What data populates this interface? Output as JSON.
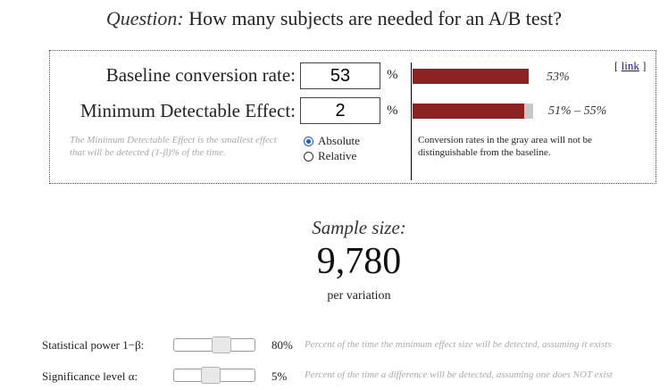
{
  "question": {
    "label": "Question:",
    "text": "How many subjects are needed for an A/B test?"
  },
  "link": {
    "open": "[",
    "text": "link",
    "close": "]"
  },
  "baseline": {
    "label": "Baseline conversion rate:",
    "value": "53",
    "unit": "%",
    "bar_text": "53%",
    "bar_fraction": 0.53
  },
  "mde": {
    "label": "Minimum Detectable Effect:",
    "value": "2",
    "unit": "%",
    "bar_text": "51% – 55%",
    "bar_red_fraction": 0.51,
    "bar_gray_to_fraction": 0.55
  },
  "mde_help": "The Minimum Detectable Effect is the smallest effect that will be detected (1-β)% of the time.",
  "mode": {
    "absolute": "Absolute",
    "relative": "Relative",
    "selected": "Absolute"
  },
  "gray_note": "Conversion rates in the gray area will not be distinguishable from the baseline.",
  "result": {
    "label": "Sample size:",
    "value": "9,780",
    "per": "per variation"
  },
  "power": {
    "label": "Statistical power 1−β:",
    "value": "80%",
    "level": 0.8,
    "help": "Percent of the time the minimum effect size will be detected, assuming it exists"
  },
  "significance": {
    "label": "Significance level α:",
    "value": "5%",
    "level": 0.05,
    "help": "Percent of the time a difference will be detected, assuming one does NOT exist"
  },
  "colors": {
    "bar_red": "#8b2323",
    "bar_gray": "#c8c8c8"
  }
}
